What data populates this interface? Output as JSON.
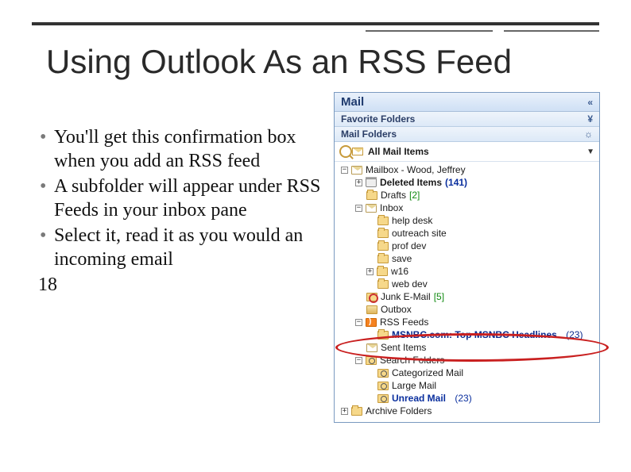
{
  "slide": {
    "title": "Using Outlook As an RSS Feed",
    "bullets": [
      "You'll get this confirmation box when you add an RSS feed",
      "A subfolder will appear under RSS Feeds in your inbox pane",
      "Select it, read it as you would an incoming email"
    ],
    "page_number": "18"
  },
  "outlook": {
    "header": "Mail",
    "favorite_folders": "Favorite Folders",
    "mail_folders": "Mail Folders",
    "all_mail": "All Mail Items",
    "mailbox": "Mailbox - Wood, Jeffrey",
    "deleted": {
      "label": "Deleted Items",
      "count": "(141)"
    },
    "drafts": {
      "label": "Drafts",
      "count": "[2]"
    },
    "inbox": "Inbox",
    "sub": {
      "help_desk": "help desk",
      "outreach": "outreach site",
      "prof_dev": "prof dev",
      "save": "save",
      "w16": "w16",
      "web_dev": "web dev"
    },
    "junk": {
      "label": "Junk E-Mail",
      "count": "[5]"
    },
    "outbox": "Outbox",
    "rss_feeds": "RSS Feeds",
    "msnbc": {
      "label": "MSNBC.com: Top MSNBC Headlines",
      "count": "(23)"
    },
    "sent": "Sent Items",
    "search_folders": "Search Folders",
    "categorized": "Categorized Mail",
    "large_mail": "Large Mail",
    "unread": {
      "label": "Unread Mail",
      "count": "(23)"
    },
    "archive": "Archive Folders"
  }
}
